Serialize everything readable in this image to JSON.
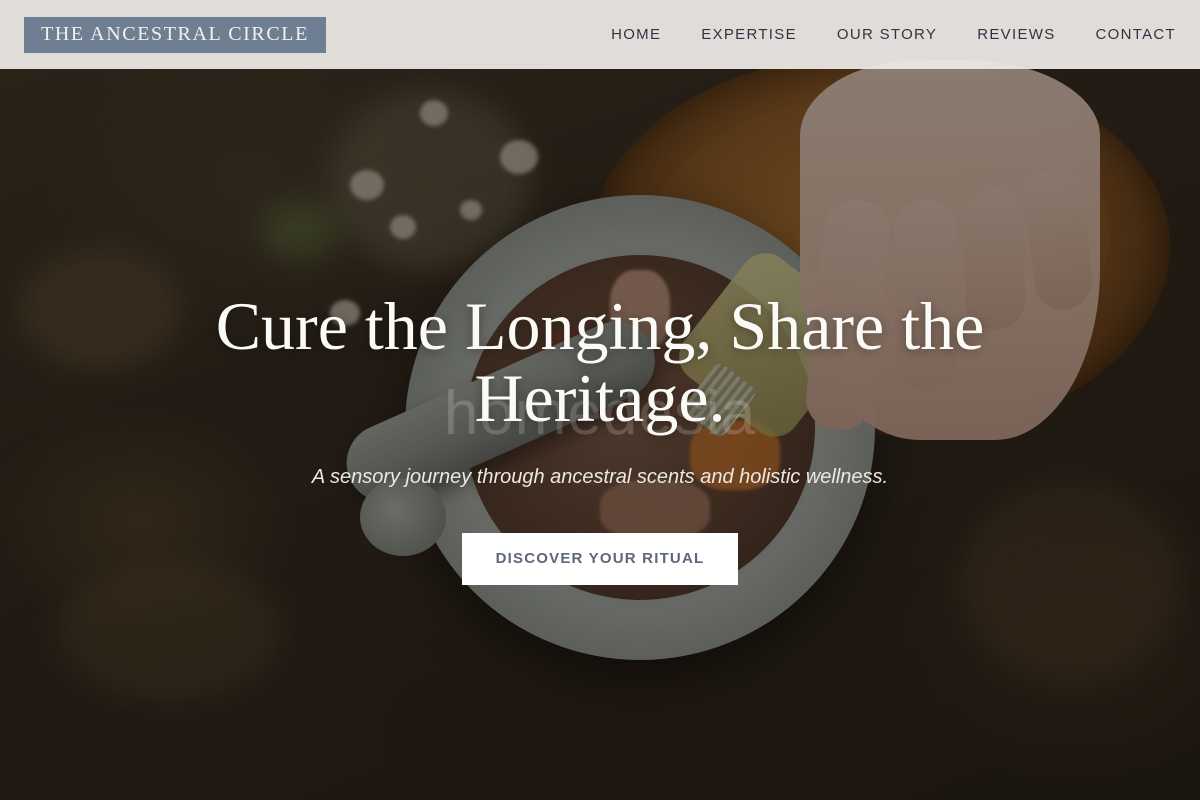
{
  "header": {
    "logo_text": "THE ANCESTRAL CIRCLE",
    "nav": [
      "HOME",
      "EXPERTISE",
      "OUR STORY",
      "REVIEWS",
      "CONTACT"
    ]
  },
  "hero": {
    "title": "Cure the Longing, Share the Heritage.",
    "watermark": "homedesia",
    "subtitle": "A sensory journey through ancestral scents and holistic wellness.",
    "cta_label": "DISCOVER YOUR RITUAL"
  },
  "colors": {
    "logo_background": "#6e7f94",
    "header_background": "#ece9e6",
    "cta_text": "#5e6778"
  }
}
